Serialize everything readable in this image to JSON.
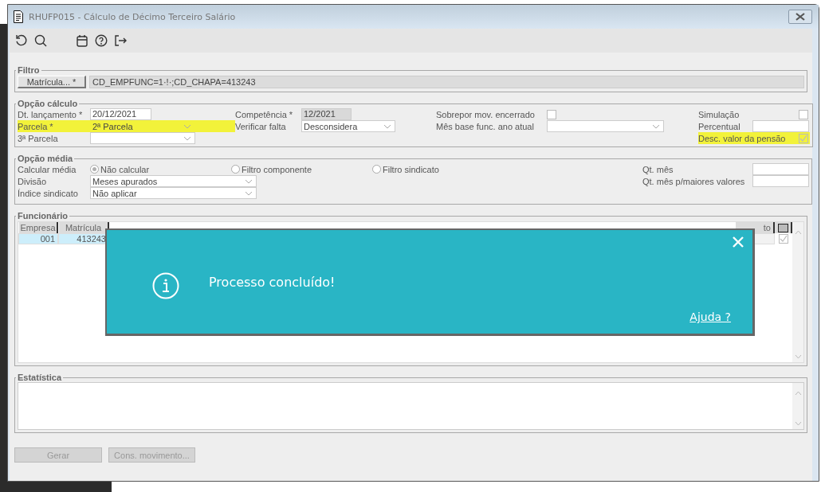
{
  "window": {
    "title": "RHUFP015 - Cálculo de Décimo Terceiro Salário"
  },
  "filtro": {
    "legend": "Filtro",
    "button": "Matrícula... *",
    "value": "CD_EMPFUNC=1·!·;CD_CHAPA=413243"
  },
  "calculo": {
    "legend": "Opção cálculo",
    "columns": [
      [
        {
          "label": "Dt. lançamento *",
          "kind": "text",
          "value": "20/12/2021",
          "disabled": false,
          "highlighted": false
        },
        {
          "label": "Parcela *",
          "kind": "select",
          "value": "2ª Parcela",
          "highlighted": true
        },
        {
          "label": "3ª Parcela",
          "kind": "select",
          "highlighted": false
        }
      ],
      [
        {
          "label": "Competência *",
          "kind": "text",
          "value": "12/2021",
          "disabled": true,
          "highlighted": false
        },
        {
          "label": "Verificar falta",
          "kind": "select",
          "value": "Desconsidera",
          "highlighted": false
        }
      ],
      [
        {
          "label": "Sobrepor mov. encerrado",
          "kind": "checkbox",
          "checked": false,
          "highlighted": false
        },
        {
          "label": "Mês base func. ano atual",
          "kind": "select",
          "highlighted": false
        }
      ],
      [
        {
          "label": "Simulação",
          "kind": "checkbox",
          "checked": false,
          "highlighted": false
        },
        {
          "label": "Percentual",
          "kind": "text",
          "disabled": false,
          "highlighted": false
        },
        {
          "label": "Desc. valor da pensão",
          "kind": "checkbox",
          "checked": true,
          "highlighted": true
        }
      ]
    ]
  },
  "media": {
    "legend": "Opção média",
    "calcular": {
      "label": "Calcular média",
      "options": [
        {
          "label": "Não calcular",
          "selected": true
        },
        {
          "label": "Filtro componente",
          "selected": false
        },
        {
          "label": "Filtro sindicato",
          "selected": false
        }
      ]
    },
    "left": [
      {
        "label": "Divisão",
        "value": "Meses apurados"
      },
      {
        "label": "Índice sindicato",
        "value": "Não aplicar"
      }
    ],
    "right": [
      {
        "label": "Qt. mês"
      },
      {
        "label": "Qt. mês p/maiores valores"
      }
    ]
  },
  "funcionario": {
    "legend": "Funcionário",
    "columns": [
      "Empresa",
      "Matrícula",
      "to"
    ],
    "select_all_indeterminate": true,
    "rows": [
      {
        "cells": [
          "001",
          "413243",
          ""
        ],
        "checked": true,
        "selected": true
      }
    ]
  },
  "estatistica": {
    "legend": "Estatística"
  },
  "buttons": [
    {
      "label": "Gerar",
      "disabled": true
    },
    {
      "label": "Cons. movimento...",
      "disabled": true
    }
  ],
  "dialog": {
    "message": "Processo concluído!",
    "link": "Ajuda ?"
  }
}
